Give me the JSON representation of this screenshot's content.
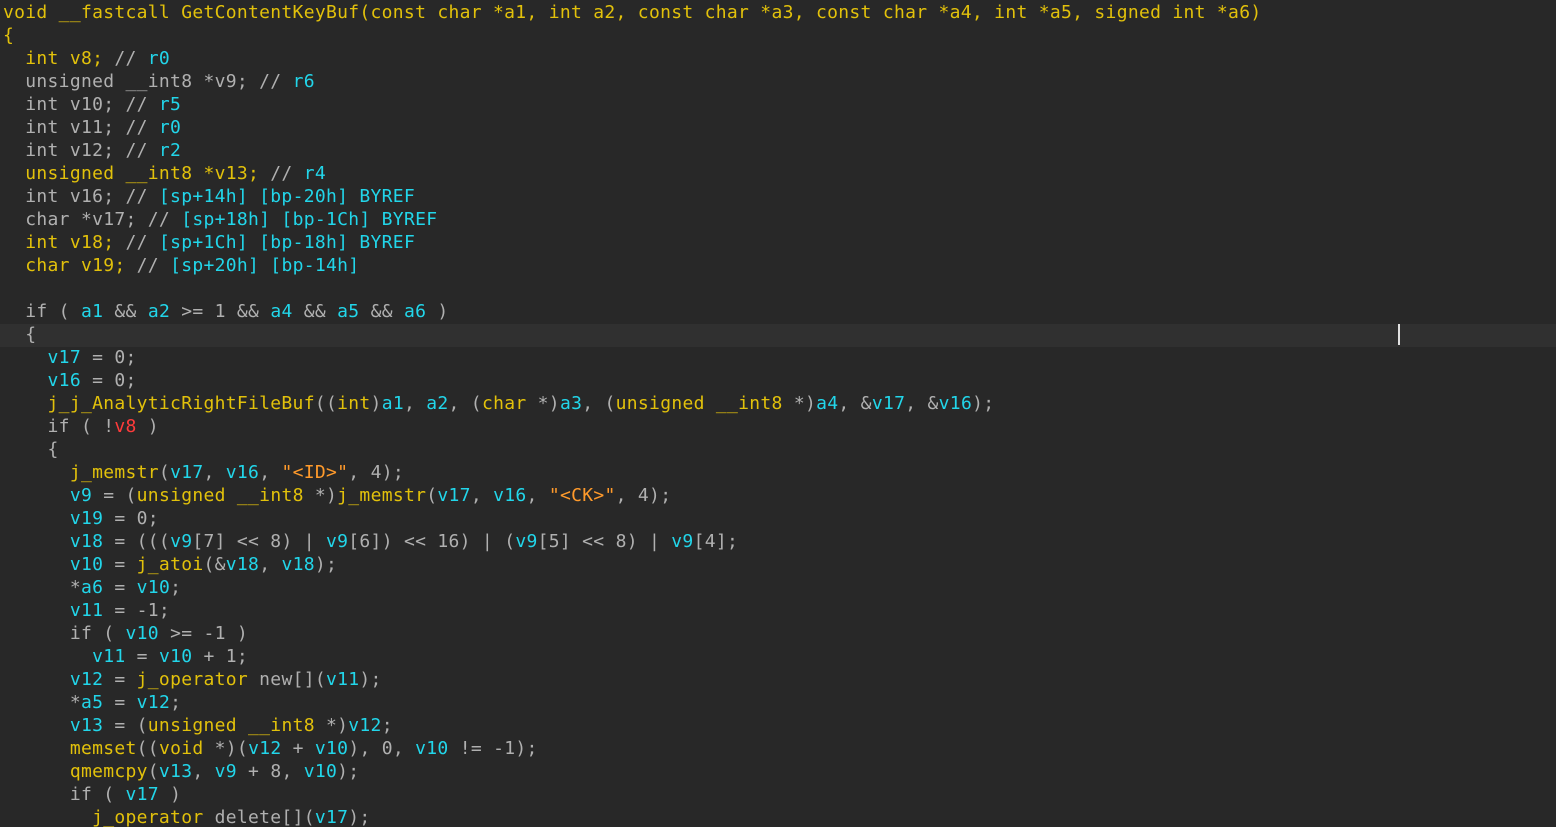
{
  "colors": {
    "background": "#282828",
    "current_line": "#303030",
    "keyword": "#e2c10b",
    "default_text": "#b0b0b0",
    "identifier": "#22d6ea",
    "error_var": "#ff3b3b",
    "string": "#ff9a2b"
  },
  "lines": [
    [
      [
        "y",
        "void __fastcall GetContentKeyBuf(const char *a1, int a2, const char *a3, const char *a4, int *a5, signed int *a6)"
      ]
    ],
    [
      [
        "y",
        "{"
      ]
    ],
    [
      [
        "y",
        "  int v8; "
      ],
      [
        "g",
        "// "
      ],
      [
        "c",
        "r0"
      ]
    ],
    [
      [
        "g",
        "  unsigned __int8 *v9; // "
      ],
      [
        "c",
        "r6"
      ]
    ],
    [
      [
        "g",
        "  int v10; // "
      ],
      [
        "c",
        "r5"
      ]
    ],
    [
      [
        "g",
        "  int v11; // "
      ],
      [
        "c",
        "r0"
      ]
    ],
    [
      [
        "g",
        "  int v12; // "
      ],
      [
        "c",
        "r2"
      ]
    ],
    [
      [
        "y",
        "  unsigned __int8 *v13; "
      ],
      [
        "g",
        "// "
      ],
      [
        "c",
        "r4"
      ]
    ],
    [
      [
        "g",
        "  int v16; // "
      ],
      [
        "c",
        "[sp+14h] [bp-20h] BYREF"
      ]
    ],
    [
      [
        "g",
        "  char *v17; // "
      ],
      [
        "c",
        "[sp+18h] [bp-1Ch] BYREF"
      ]
    ],
    [
      [
        "y",
        "  int v18; "
      ],
      [
        "g",
        "// "
      ],
      [
        "c",
        "[sp+1Ch] [bp-18h] BYREF"
      ]
    ],
    [
      [
        "y",
        "  char v19; "
      ],
      [
        "g",
        "// "
      ],
      [
        "c",
        "[sp+20h] [bp-14h]"
      ]
    ],
    [
      [
        "g",
        ""
      ]
    ],
    [
      [
        "g",
        "  if ( "
      ],
      [
        "c",
        "a1"
      ],
      [
        "g",
        " && "
      ],
      [
        "c",
        "a2"
      ],
      [
        "g",
        " >= 1 && "
      ],
      [
        "c",
        "a4"
      ],
      [
        "g",
        " && "
      ],
      [
        "c",
        "a5"
      ],
      [
        "g",
        " && "
      ],
      [
        "c",
        "a6"
      ],
      [
        "g",
        " )"
      ]
    ],
    [
      [
        "g",
        "  {"
      ]
    ],
    [
      [
        "c",
        "    v17"
      ],
      [
        "g",
        " = 0;"
      ]
    ],
    [
      [
        "c",
        "    v16"
      ],
      [
        "g",
        " = 0;"
      ]
    ],
    [
      [
        "y",
        "    j_j_AnalyticRightFileBuf"
      ],
      [
        "g",
        "(("
      ],
      [
        "y",
        "int"
      ],
      [
        "g",
        ")"
      ],
      [
        "c",
        "a1"
      ],
      [
        "g",
        ", "
      ],
      [
        "c",
        "a2"
      ],
      [
        "g",
        ", ("
      ],
      [
        "y",
        "char"
      ],
      [
        "g",
        " *)"
      ],
      [
        "c",
        "a3"
      ],
      [
        "g",
        ", ("
      ],
      [
        "y",
        "unsigned __int8"
      ],
      [
        "g",
        " *)"
      ],
      [
        "c",
        "a4"
      ],
      [
        "g",
        ", &"
      ],
      [
        "c",
        "v17"
      ],
      [
        "g",
        ", &"
      ],
      [
        "c",
        "v16"
      ],
      [
        "g",
        ");"
      ]
    ],
    [
      [
        "g",
        "    if ( !"
      ],
      [
        "r",
        "v8"
      ],
      [
        "g",
        " )"
      ]
    ],
    [
      [
        "g",
        "    {"
      ]
    ],
    [
      [
        "y",
        "      j_memstr"
      ],
      [
        "g",
        "("
      ],
      [
        "c",
        "v17"
      ],
      [
        "g",
        ", "
      ],
      [
        "c",
        "v16"
      ],
      [
        "g",
        ", "
      ],
      [
        "o",
        "\"<ID>\""
      ],
      [
        "g",
        ", 4);"
      ]
    ],
    [
      [
        "c",
        "      v9"
      ],
      [
        "g",
        " = ("
      ],
      [
        "y",
        "unsigned __int8"
      ],
      [
        "g",
        " *)"
      ],
      [
        "y",
        "j_memstr"
      ],
      [
        "g",
        "("
      ],
      [
        "c",
        "v17"
      ],
      [
        "g",
        ", "
      ],
      [
        "c",
        "v16"
      ],
      [
        "g",
        ", "
      ],
      [
        "o",
        "\"<CK>\""
      ],
      [
        "g",
        ", 4);"
      ]
    ],
    [
      [
        "c",
        "      v19"
      ],
      [
        "g",
        " = 0;"
      ]
    ],
    [
      [
        "c",
        "      v18"
      ],
      [
        "g",
        " = ((("
      ],
      [
        "c",
        "v9"
      ],
      [
        "g",
        "[7] << 8) | "
      ],
      [
        "c",
        "v9"
      ],
      [
        "g",
        "[6]) << 16) | ("
      ],
      [
        "c",
        "v9"
      ],
      [
        "g",
        "[5] << 8) | "
      ],
      [
        "c",
        "v9"
      ],
      [
        "g",
        "[4];"
      ]
    ],
    [
      [
        "c",
        "      v10"
      ],
      [
        "g",
        " = "
      ],
      [
        "y",
        "j_atoi"
      ],
      [
        "g",
        "(&"
      ],
      [
        "c",
        "v18"
      ],
      [
        "g",
        ", "
      ],
      [
        "c",
        "v18"
      ],
      [
        "g",
        ");"
      ]
    ],
    [
      [
        "g",
        "      *"
      ],
      [
        "c",
        "a6"
      ],
      [
        "g",
        " = "
      ],
      [
        "c",
        "v10"
      ],
      [
        "g",
        ";"
      ]
    ],
    [
      [
        "c",
        "      v11"
      ],
      [
        "g",
        " = -1;"
      ]
    ],
    [
      [
        "g",
        "      if ( "
      ],
      [
        "c",
        "v10"
      ],
      [
        "g",
        " >= -1 )"
      ]
    ],
    [
      [
        "c",
        "        v11"
      ],
      [
        "g",
        " = "
      ],
      [
        "c",
        "v10"
      ],
      [
        "g",
        " + 1;"
      ]
    ],
    [
      [
        "c",
        "      v12"
      ],
      [
        "g",
        " = "
      ],
      [
        "y",
        "j_operator"
      ],
      [
        "g",
        " new[]("
      ],
      [
        "c",
        "v11"
      ],
      [
        "g",
        ");"
      ]
    ],
    [
      [
        "g",
        "      *"
      ],
      [
        "c",
        "a5"
      ],
      [
        "g",
        " = "
      ],
      [
        "c",
        "v12"
      ],
      [
        "g",
        ";"
      ]
    ],
    [
      [
        "c",
        "      v13"
      ],
      [
        "g",
        " = ("
      ],
      [
        "y",
        "unsigned __int8"
      ],
      [
        "g",
        " *)"
      ],
      [
        "c",
        "v12"
      ],
      [
        "g",
        ";"
      ]
    ],
    [
      [
        "y",
        "      memset"
      ],
      [
        "g",
        "(("
      ],
      [
        "y",
        "void"
      ],
      [
        "g",
        " *)("
      ],
      [
        "c",
        "v12"
      ],
      [
        "g",
        " + "
      ],
      [
        "c",
        "v10"
      ],
      [
        "g",
        "), 0, "
      ],
      [
        "c",
        "v10"
      ],
      [
        "g",
        " != -1);"
      ]
    ],
    [
      [
        "y",
        "      qmemcpy"
      ],
      [
        "g",
        "("
      ],
      [
        "c",
        "v13"
      ],
      [
        "g",
        ", "
      ],
      [
        "c",
        "v9"
      ],
      [
        "g",
        " + 8, "
      ],
      [
        "c",
        "v10"
      ],
      [
        "g",
        ");"
      ]
    ],
    [
      [
        "g",
        "      if ( "
      ],
      [
        "c",
        "v17"
      ],
      [
        "g",
        " )"
      ]
    ],
    [
      [
        "y",
        "        j_operator"
      ],
      [
        "g",
        " delete[]("
      ],
      [
        "c",
        "v17"
      ],
      [
        "g",
        ");"
      ]
    ]
  ]
}
